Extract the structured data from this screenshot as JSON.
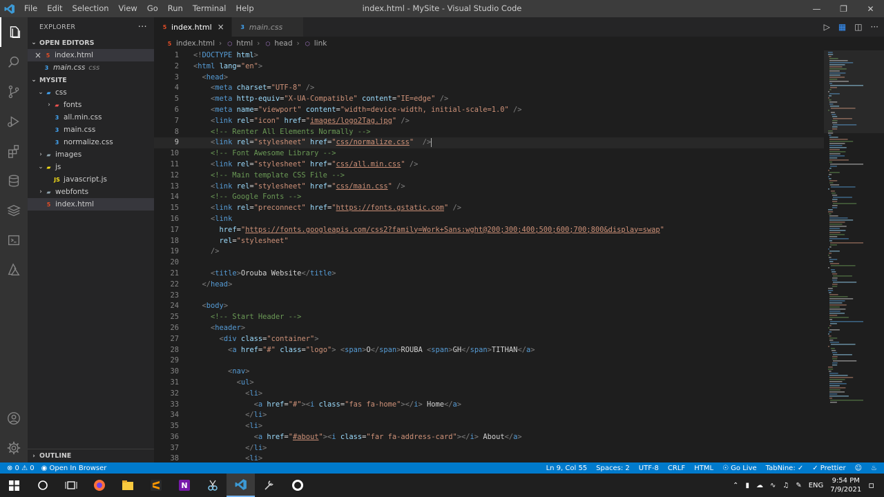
{
  "titlebar": {
    "menu": [
      "File",
      "Edit",
      "Selection",
      "View",
      "Go",
      "Run",
      "Terminal",
      "Help"
    ],
    "title": "index.html - MySite - Visual Studio Code"
  },
  "sidebar": {
    "title": "EXPLORER",
    "open_editors_label": "OPEN EDITORS",
    "open_editors": [
      {
        "name": "index.html",
        "type": "html",
        "close": "×"
      },
      {
        "name": "main.css",
        "type": "css",
        "desc": "css"
      }
    ],
    "project_label": "MYSITE",
    "tree": [
      {
        "name": "css",
        "kind": "folder-css",
        "depth": 1,
        "open": true
      },
      {
        "name": "fonts",
        "kind": "folder-font",
        "depth": 2,
        "open": false
      },
      {
        "name": "all.min.css",
        "kind": "css",
        "depth": 2
      },
      {
        "name": "main.css",
        "kind": "css",
        "depth": 2
      },
      {
        "name": "normalize.css",
        "kind": "css",
        "depth": 2
      },
      {
        "name": "images",
        "kind": "folder",
        "depth": 1,
        "open": false
      },
      {
        "name": "js",
        "kind": "folder-js",
        "depth": 1,
        "open": true
      },
      {
        "name": "javascript.js",
        "kind": "js",
        "depth": 2
      },
      {
        "name": "webfonts",
        "kind": "folder",
        "depth": 1,
        "open": false
      },
      {
        "name": "index.html",
        "kind": "html",
        "depth": 1,
        "selected": true
      }
    ],
    "outline_label": "OUTLINE"
  },
  "tabs": [
    {
      "name": "index.html",
      "active": true,
      "close": "×"
    },
    {
      "name": "main.css",
      "active": false
    }
  ],
  "breadcrumb": [
    "index.html",
    "html",
    "head",
    "link"
  ],
  "editor": {
    "current_line": 9,
    "lines": [
      [
        [
          "b",
          "<!"
        ],
        [
          "t",
          "DOCTYPE"
        ],
        [
          "x",
          " "
        ],
        [
          "a",
          "html"
        ],
        [
          "b",
          ">"
        ]
      ],
      [
        [
          "b",
          "<"
        ],
        [
          "t",
          "html"
        ],
        [
          "x",
          " "
        ],
        [
          "a",
          "lang"
        ],
        [
          "x",
          "="
        ],
        [
          "s",
          "\"en\""
        ],
        [
          "b",
          ">"
        ]
      ],
      [
        [
          "x",
          "  "
        ],
        [
          "b",
          "<"
        ],
        [
          "t",
          "head"
        ],
        [
          "b",
          ">"
        ]
      ],
      [
        [
          "x",
          "    "
        ],
        [
          "b",
          "<"
        ],
        [
          "t",
          "meta"
        ],
        [
          "x",
          " "
        ],
        [
          "a",
          "charset"
        ],
        [
          "x",
          "="
        ],
        [
          "s",
          "\"UTF-8\""
        ],
        [
          "x",
          " "
        ],
        [
          "b",
          "/>"
        ]
      ],
      [
        [
          "x",
          "    "
        ],
        [
          "b",
          "<"
        ],
        [
          "t",
          "meta"
        ],
        [
          "x",
          " "
        ],
        [
          "a",
          "http-equiv"
        ],
        [
          "x",
          "="
        ],
        [
          "s",
          "\"X-UA-Compatible\""
        ],
        [
          "x",
          " "
        ],
        [
          "a",
          "content"
        ],
        [
          "x",
          "="
        ],
        [
          "s",
          "\"IE=edge\""
        ],
        [
          "x",
          " "
        ],
        [
          "b",
          "/>"
        ]
      ],
      [
        [
          "x",
          "    "
        ],
        [
          "b",
          "<"
        ],
        [
          "t",
          "meta"
        ],
        [
          "x",
          " "
        ],
        [
          "a",
          "name"
        ],
        [
          "x",
          "="
        ],
        [
          "s",
          "\"viewport\""
        ],
        [
          "x",
          " "
        ],
        [
          "a",
          "content"
        ],
        [
          "x",
          "="
        ],
        [
          "s",
          "\"width=device-width, initial-scale=1.0\""
        ],
        [
          "x",
          " "
        ],
        [
          "b",
          "/>"
        ]
      ],
      [
        [
          "x",
          "    "
        ],
        [
          "b",
          "<"
        ],
        [
          "t",
          "link"
        ],
        [
          "x",
          " "
        ],
        [
          "a",
          "rel"
        ],
        [
          "x",
          "="
        ],
        [
          "s",
          "\"icon\""
        ],
        [
          "x",
          " "
        ],
        [
          "a",
          "href"
        ],
        [
          "x",
          "="
        ],
        [
          "s",
          "\""
        ],
        [
          "su",
          "images/logo2Tag.jpg"
        ],
        [
          "s",
          "\""
        ],
        [
          "x",
          " "
        ],
        [
          "b",
          "/>"
        ]
      ],
      [
        [
          "x",
          "    "
        ],
        [
          "c",
          "<!-- Renter All Elements Normally -->"
        ]
      ],
      [
        [
          "x",
          "    "
        ],
        [
          "b",
          "<"
        ],
        [
          "t",
          "link"
        ],
        [
          "x",
          " "
        ],
        [
          "a",
          "rel"
        ],
        [
          "x",
          "="
        ],
        [
          "s",
          "\"stylesheet\""
        ],
        [
          "x",
          " "
        ],
        [
          "a",
          "href"
        ],
        [
          "x",
          "="
        ],
        [
          "s",
          "\""
        ],
        [
          "su",
          "css/normalize.css"
        ],
        [
          "s",
          "\""
        ],
        [
          "x",
          "  "
        ],
        [
          "b",
          "/>"
        ]
      ],
      [
        [
          "x",
          "    "
        ],
        [
          "c",
          "<!-- Font Awesome Library -->"
        ]
      ],
      [
        [
          "x",
          "    "
        ],
        [
          "b",
          "<"
        ],
        [
          "t",
          "link"
        ],
        [
          "x",
          " "
        ],
        [
          "a",
          "rel"
        ],
        [
          "x",
          "="
        ],
        [
          "s",
          "\"stylesheet\""
        ],
        [
          "x",
          " "
        ],
        [
          "a",
          "href"
        ],
        [
          "x",
          "="
        ],
        [
          "s",
          "\""
        ],
        [
          "su",
          "css/all.min.css"
        ],
        [
          "s",
          "\""
        ],
        [
          "x",
          " "
        ],
        [
          "b",
          "/>"
        ]
      ],
      [
        [
          "x",
          "    "
        ],
        [
          "c",
          "<!-- Main template CSS File -->"
        ]
      ],
      [
        [
          "x",
          "    "
        ],
        [
          "b",
          "<"
        ],
        [
          "t",
          "link"
        ],
        [
          "x",
          " "
        ],
        [
          "a",
          "rel"
        ],
        [
          "x",
          "="
        ],
        [
          "s",
          "\"stylesheet\""
        ],
        [
          "x",
          " "
        ],
        [
          "a",
          "href"
        ],
        [
          "x",
          "="
        ],
        [
          "s",
          "\""
        ],
        [
          "su",
          "css/main.css"
        ],
        [
          "s",
          "\""
        ],
        [
          "x",
          " "
        ],
        [
          "b",
          "/>"
        ]
      ],
      [
        [
          "x",
          "    "
        ],
        [
          "c",
          "<!-- Google Fonts -->"
        ]
      ],
      [
        [
          "x",
          "    "
        ],
        [
          "b",
          "<"
        ],
        [
          "t",
          "link"
        ],
        [
          "x",
          " "
        ],
        [
          "a",
          "rel"
        ],
        [
          "x",
          "="
        ],
        [
          "s",
          "\"preconnect\""
        ],
        [
          "x",
          " "
        ],
        [
          "a",
          "href"
        ],
        [
          "x",
          "="
        ],
        [
          "s",
          "\""
        ],
        [
          "su",
          "https://fonts.gstatic.com"
        ],
        [
          "s",
          "\""
        ],
        [
          "x",
          " "
        ],
        [
          "b",
          "/>"
        ]
      ],
      [
        [
          "x",
          "    "
        ],
        [
          "b",
          "<"
        ],
        [
          "t",
          "link"
        ]
      ],
      [
        [
          "x",
          "      "
        ],
        [
          "a",
          "href"
        ],
        [
          "x",
          "="
        ],
        [
          "s",
          "\""
        ],
        [
          "su",
          "https://fonts.googleapis.com/css2?family=Work+Sans:wght@200;300;400;500;600;700;800&display=swap"
        ],
        [
          "s",
          "\""
        ]
      ],
      [
        [
          "x",
          "      "
        ],
        [
          "a",
          "rel"
        ],
        [
          "x",
          "="
        ],
        [
          "s",
          "\"stylesheet\""
        ]
      ],
      [
        [
          "x",
          "    "
        ],
        [
          "b",
          "/>"
        ]
      ],
      [
        [
          "x",
          ""
        ]
      ],
      [
        [
          "x",
          "    "
        ],
        [
          "b",
          "<"
        ],
        [
          "t",
          "title"
        ],
        [
          "b",
          ">"
        ],
        [
          "x",
          "Orouba Website"
        ],
        [
          "b",
          "</"
        ],
        [
          "t",
          "title"
        ],
        [
          "b",
          ">"
        ]
      ],
      [
        [
          "x",
          "  "
        ],
        [
          "b",
          "</"
        ],
        [
          "t",
          "head"
        ],
        [
          "b",
          ">"
        ]
      ],
      [
        [
          "x",
          ""
        ]
      ],
      [
        [
          "x",
          "  "
        ],
        [
          "b",
          "<"
        ],
        [
          "t",
          "body"
        ],
        [
          "b",
          ">"
        ]
      ],
      [
        [
          "x",
          "    "
        ],
        [
          "c",
          "<!-- Start Header -->"
        ]
      ],
      [
        [
          "x",
          "    "
        ],
        [
          "b",
          "<"
        ],
        [
          "t",
          "header"
        ],
        [
          "b",
          ">"
        ]
      ],
      [
        [
          "x",
          "      "
        ],
        [
          "b",
          "<"
        ],
        [
          "t",
          "div"
        ],
        [
          "x",
          " "
        ],
        [
          "a",
          "class"
        ],
        [
          "x",
          "="
        ],
        [
          "s",
          "\"container\""
        ],
        [
          "b",
          ">"
        ]
      ],
      [
        [
          "x",
          "        "
        ],
        [
          "b",
          "<"
        ],
        [
          "t",
          "a"
        ],
        [
          "x",
          " "
        ],
        [
          "a",
          "href"
        ],
        [
          "x",
          "="
        ],
        [
          "s",
          "\"#\""
        ],
        [
          "x",
          " "
        ],
        [
          "a",
          "class"
        ],
        [
          "x",
          "="
        ],
        [
          "s",
          "\"logo\""
        ],
        [
          "b",
          ">"
        ],
        [
          "x",
          " "
        ],
        [
          "b",
          "<"
        ],
        [
          "t",
          "span"
        ],
        [
          "b",
          ">"
        ],
        [
          "x",
          "O"
        ],
        [
          "b",
          "</"
        ],
        [
          "t",
          "span"
        ],
        [
          "b",
          ">"
        ],
        [
          "x",
          "ROUBA "
        ],
        [
          "b",
          "<"
        ],
        [
          "t",
          "span"
        ],
        [
          "b",
          ">"
        ],
        [
          "x",
          "GH"
        ],
        [
          "b",
          "</"
        ],
        [
          "t",
          "span"
        ],
        [
          "b",
          ">"
        ],
        [
          "x",
          "TITHAN"
        ],
        [
          "b",
          "</"
        ],
        [
          "t",
          "a"
        ],
        [
          "b",
          ">"
        ]
      ],
      [
        [
          "x",
          ""
        ]
      ],
      [
        [
          "x",
          "        "
        ],
        [
          "b",
          "<"
        ],
        [
          "t",
          "nav"
        ],
        [
          "b",
          ">"
        ]
      ],
      [
        [
          "x",
          "          "
        ],
        [
          "b",
          "<"
        ],
        [
          "t",
          "ul"
        ],
        [
          "b",
          ">"
        ]
      ],
      [
        [
          "x",
          "            "
        ],
        [
          "b",
          "<"
        ],
        [
          "t",
          "li"
        ],
        [
          "b",
          ">"
        ]
      ],
      [
        [
          "x",
          "              "
        ],
        [
          "b",
          "<"
        ],
        [
          "t",
          "a"
        ],
        [
          "x",
          " "
        ],
        [
          "a",
          "href"
        ],
        [
          "x",
          "="
        ],
        [
          "s",
          "\"#\""
        ],
        [
          "b",
          ">"
        ],
        [
          "b",
          "<"
        ],
        [
          "t",
          "i"
        ],
        [
          "x",
          " "
        ],
        [
          "a",
          "class"
        ],
        [
          "x",
          "="
        ],
        [
          "s",
          "\"fas fa-home\""
        ],
        [
          "b",
          ">"
        ],
        [
          "b",
          "</"
        ],
        [
          "t",
          "i"
        ],
        [
          "b",
          ">"
        ],
        [
          "x",
          " Home"
        ],
        [
          "b",
          "</"
        ],
        [
          "t",
          "a"
        ],
        [
          "b",
          ">"
        ]
      ],
      [
        [
          "x",
          "            "
        ],
        [
          "b",
          "</"
        ],
        [
          "t",
          "li"
        ],
        [
          "b",
          ">"
        ]
      ],
      [
        [
          "x",
          "            "
        ],
        [
          "b",
          "<"
        ],
        [
          "t",
          "li"
        ],
        [
          "b",
          ">"
        ]
      ],
      [
        [
          "x",
          "              "
        ],
        [
          "b",
          "<"
        ],
        [
          "t",
          "a"
        ],
        [
          "x",
          " "
        ],
        [
          "a",
          "href"
        ],
        [
          "x",
          "="
        ],
        [
          "s",
          "\""
        ],
        [
          "su",
          "#about"
        ],
        [
          "s",
          "\""
        ],
        [
          "b",
          ">"
        ],
        [
          "b",
          "<"
        ],
        [
          "t",
          "i"
        ],
        [
          "x",
          " "
        ],
        [
          "a",
          "class"
        ],
        [
          "x",
          "="
        ],
        [
          "s",
          "\"far fa-address-card\""
        ],
        [
          "b",
          ">"
        ],
        [
          "b",
          "</"
        ],
        [
          "t",
          "i"
        ],
        [
          "b",
          ">"
        ],
        [
          "x",
          " About"
        ],
        [
          "b",
          "</"
        ],
        [
          "t",
          "a"
        ],
        [
          "b",
          ">"
        ]
      ],
      [
        [
          "x",
          "            "
        ],
        [
          "b",
          "</"
        ],
        [
          "t",
          "li"
        ],
        [
          "b",
          ">"
        ]
      ],
      [
        [
          "x",
          "            "
        ],
        [
          "b",
          "<"
        ],
        [
          "t",
          "li"
        ],
        [
          "b",
          ">"
        ]
      ]
    ]
  },
  "statusbar": {
    "errors": "⊗ 0 ⚠ 0",
    "open_browser": "Open In Browser",
    "position": "Ln 9, Col 55",
    "spaces": "Spaces: 2",
    "encoding": "UTF-8",
    "eol": "CRLF",
    "language": "HTML",
    "golive": "Go Live",
    "tabnine": "TabNine: ✓",
    "prettier": "✓ Prettier"
  },
  "taskbar": {
    "lang": "ENG",
    "time": "9:54 PM",
    "date": "7/9/2021"
  },
  "colors": {
    "accent": "#007acc",
    "tag": "#569cd6",
    "attr": "#9cdcfe",
    "string": "#ce9178",
    "comment": "#6a9955"
  }
}
